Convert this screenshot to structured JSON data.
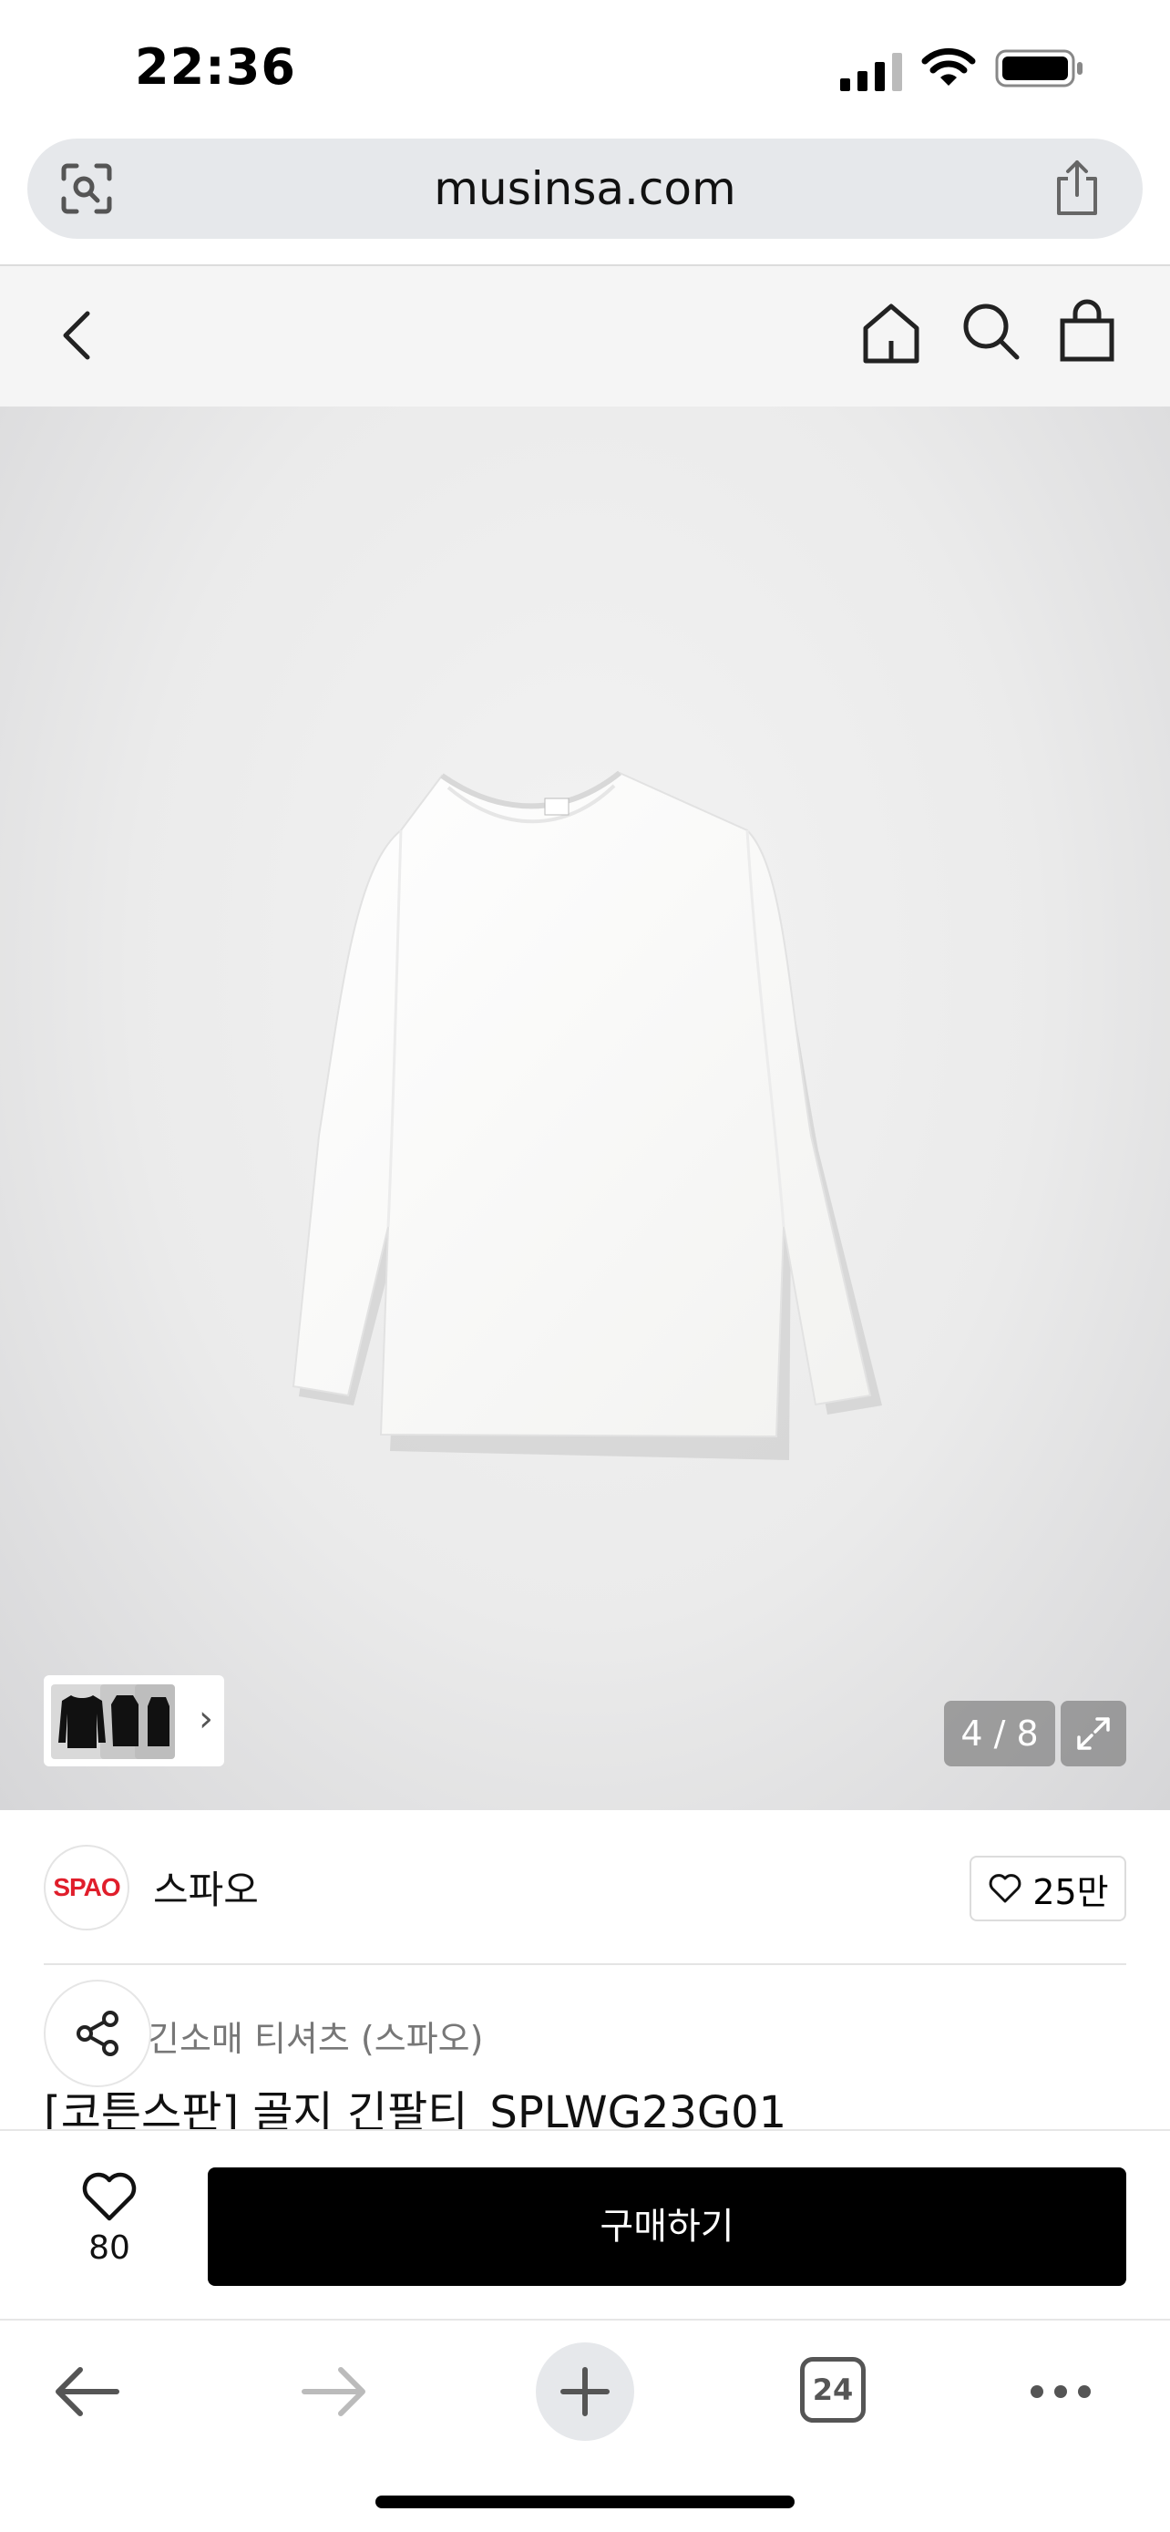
{
  "status_bar": {
    "time": "22:36"
  },
  "browser": {
    "url": "musinsa.com",
    "tab_count": "24"
  },
  "gallery": {
    "counter": "4 / 8"
  },
  "brand": {
    "logo_text": "SPAO",
    "name": "스파오",
    "likes": "25만"
  },
  "product": {
    "category": "긴소매 티셔츠 (스파오)",
    "title": "[코튼스판] 골지 긴팔티_SPLWG23G01"
  },
  "purchase": {
    "wish_count": "80",
    "buy_label": "구매하기"
  },
  "colors": {
    "buy_button": "#000000",
    "brand_red": "#e01e2b",
    "url_bar": "#e6e8eb"
  }
}
